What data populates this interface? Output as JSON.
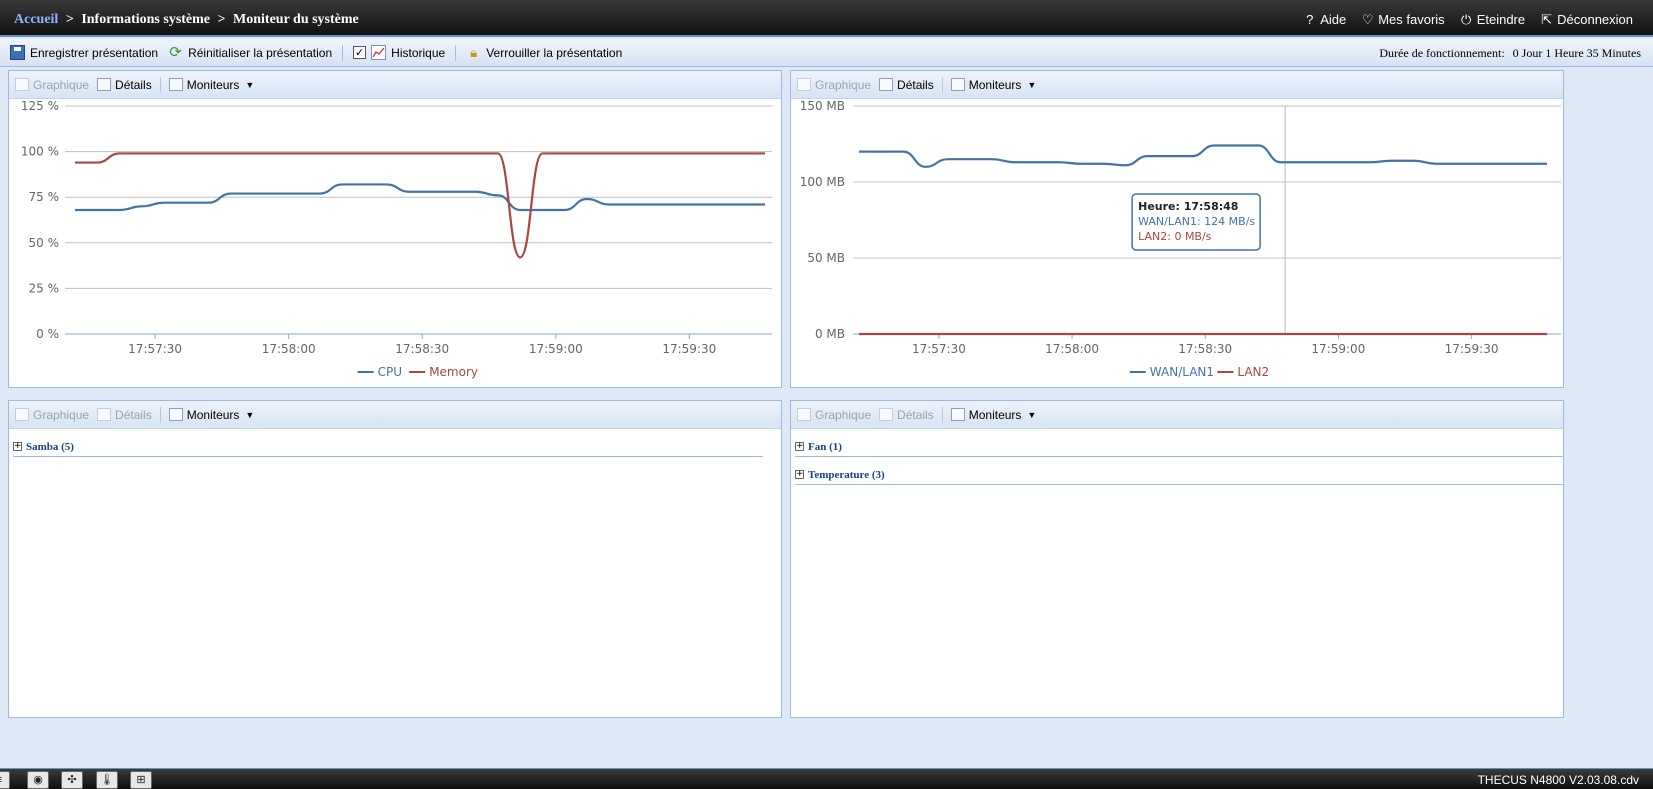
{
  "breadcrumb": {
    "home": "Accueil",
    "sep1": ">",
    "section": "Informations système",
    "sep2": ">",
    "page": "Moniteur du système"
  },
  "topnav": {
    "help": "Aide",
    "favorites": "Mes favoris",
    "shutdown": "Eteindre",
    "logout": "Déconnexion"
  },
  "toolbar": {
    "save": "Enregistrer présentation",
    "reset": "Réinitialiser la présentation",
    "history": "Historique",
    "history_checked": true,
    "lock": "Verrouiller la présentation"
  },
  "uptime": {
    "label": "Durée de fonctionnement:",
    "value": "0 Jour 1 Heure 35 Minutes"
  },
  "panel_toolbar": {
    "graph": "Graphique",
    "details": "Détails",
    "monitors": "Moniteurs"
  },
  "panels": {
    "bottom_left": {
      "nodes": [
        {
          "label": "Samba (5)"
        }
      ]
    },
    "bottom_right": {
      "nodes": [
        {
          "label": "Fan (1)"
        },
        {
          "label": "Temperature (3)"
        }
      ]
    }
  },
  "chart_data": [
    {
      "type": "line",
      "x_ticks": [
        "17:57:30",
        "17:58:00",
        "17:58:30",
        "17:59:00",
        "17:59:30"
      ],
      "ylim": [
        0,
        125
      ],
      "y_ticks": [
        "125 %",
        "100 %",
        "75 %",
        "50 %",
        "25 %",
        "0 %"
      ],
      "y_tick_values": [
        125,
        100,
        75,
        50,
        25,
        0
      ],
      "grid": true,
      "legend": "bottom-center",
      "x": [
        "17:57:12",
        "17:57:17",
        "17:57:22",
        "17:57:27",
        "17:57:32",
        "17:57:37",
        "17:57:42",
        "17:57:47",
        "17:57:52",
        "17:57:57",
        "17:58:02",
        "17:58:07",
        "17:58:12",
        "17:58:17",
        "17:58:22",
        "17:58:27",
        "17:58:32",
        "17:58:37",
        "17:58:42",
        "17:58:47",
        "17:58:52",
        "17:58:57",
        "17:59:02",
        "17:59:07",
        "17:59:12",
        "17:59:17",
        "17:59:22",
        "17:59:27",
        "17:59:32",
        "17:59:37",
        "17:59:42",
        "17:59:47"
      ],
      "series": [
        {
          "name": "CPU",
          "color": "#4572a7",
          "values": [
            68,
            68,
            68,
            70,
            72,
            72,
            72,
            77,
            77,
            77,
            77,
            77,
            82,
            82,
            82,
            78,
            78,
            78,
            78,
            76,
            68,
            68,
            68,
            74,
            71,
            71,
            71,
            71,
            71,
            71,
            71,
            71
          ]
        },
        {
          "name": "Memory",
          "color": "#aa4643",
          "values": [
            94,
            94,
            99,
            99,
            99,
            99,
            99,
            99,
            99,
            99,
            99,
            99,
            99,
            99,
            99,
            99,
            99,
            99,
            99,
            99,
            42,
            99,
            99,
            99,
            99,
            99,
            99,
            99,
            99,
            99,
            99,
            99
          ]
        }
      ]
    },
    {
      "type": "line",
      "x_ticks": [
        "17:57:30",
        "17:58:00",
        "17:58:30",
        "17:59:00",
        "17:59:30"
      ],
      "ylim": [
        0,
        150
      ],
      "y_ticks": [
        "150 MB",
        "100 MB",
        "50 MB",
        "0 MB"
      ],
      "y_tick_values": [
        150,
        100,
        50,
        0
      ],
      "grid": true,
      "legend": "bottom-center",
      "x": [
        "17:57:12",
        "17:57:17",
        "17:57:22",
        "17:57:27",
        "17:57:32",
        "17:57:37",
        "17:57:42",
        "17:57:47",
        "17:57:52",
        "17:57:57",
        "17:58:02",
        "17:58:07",
        "17:58:12",
        "17:58:17",
        "17:58:22",
        "17:58:27",
        "17:58:32",
        "17:58:37",
        "17:58:42",
        "17:58:47",
        "17:58:52",
        "17:58:57",
        "17:59:02",
        "17:59:07",
        "17:59:12",
        "17:59:17",
        "17:59:22",
        "17:59:27",
        "17:59:32",
        "17:59:37",
        "17:59:42",
        "17:59:47"
      ],
      "series": [
        {
          "name": "WAN/LAN1",
          "color": "#4572a7",
          "values": [
            120,
            120,
            120,
            110,
            115,
            115,
            115,
            113,
            113,
            113,
            112,
            112,
            111,
            117,
            117,
            117,
            124,
            124,
            124,
            113,
            113,
            113,
            113,
            113,
            114,
            114,
            112,
            112,
            112,
            112,
            112,
            112
          ]
        },
        {
          "name": "LAN2",
          "color": "#aa4643",
          "values": [
            0,
            0,
            0,
            0,
            0,
            0,
            0,
            0,
            0,
            0,
            0,
            0,
            0,
            0,
            0,
            0,
            0,
            0,
            0,
            0,
            0,
            0,
            0,
            0,
            0,
            0,
            0,
            0,
            0,
            0,
            0,
            0
          ]
        }
      ],
      "tooltip": {
        "title": "Heure: 17:58:48",
        "lines": [
          {
            "label": "WAN/LAN1: 124 MB/s",
            "color": "#4572a7"
          },
          {
            "label": "LAN2: 0 MB/s",
            "color": "#aa4643"
          }
        ],
        "crosshair_x": "17:58:48"
      }
    }
  ],
  "taskbar": {
    "version": "THECUS N4800 V2.03.08.cdv",
    "icons": [
      "menu-icon",
      "disk-icon",
      "fan-icon",
      "thermometer-icon",
      "network-icon"
    ]
  }
}
